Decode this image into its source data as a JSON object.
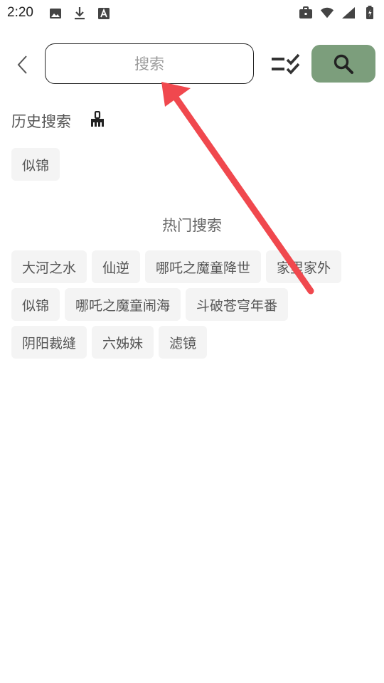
{
  "status_bar": {
    "time": "2:20",
    "left_icons": [
      "image-icon",
      "download-icon",
      "font-icon"
    ],
    "right_icons": [
      "briefcase-icon",
      "wifi-icon",
      "signal-icon",
      "battery-icon"
    ]
  },
  "header": {
    "back_icon": "chevron-left-icon",
    "search_placeholder": "搜索",
    "list_check_icon": "list-check-icon",
    "search_button_icon": "search-icon",
    "search_button_color": "#7c9e7c"
  },
  "history": {
    "title": "历史搜索",
    "clear_icon": "broom-icon",
    "tags": [
      "似锦"
    ]
  },
  "hot": {
    "title": "热门搜索",
    "tags": [
      "大河之水",
      "仙逆",
      "哪吒之魔童降世",
      "家里家外",
      "似锦",
      "哪吒之魔童闹海",
      "斗破苍穹年番",
      "阴阳裁缝",
      "六姊妹",
      "滤镜"
    ]
  },
  "annotation": {
    "color": "#f0484e"
  }
}
